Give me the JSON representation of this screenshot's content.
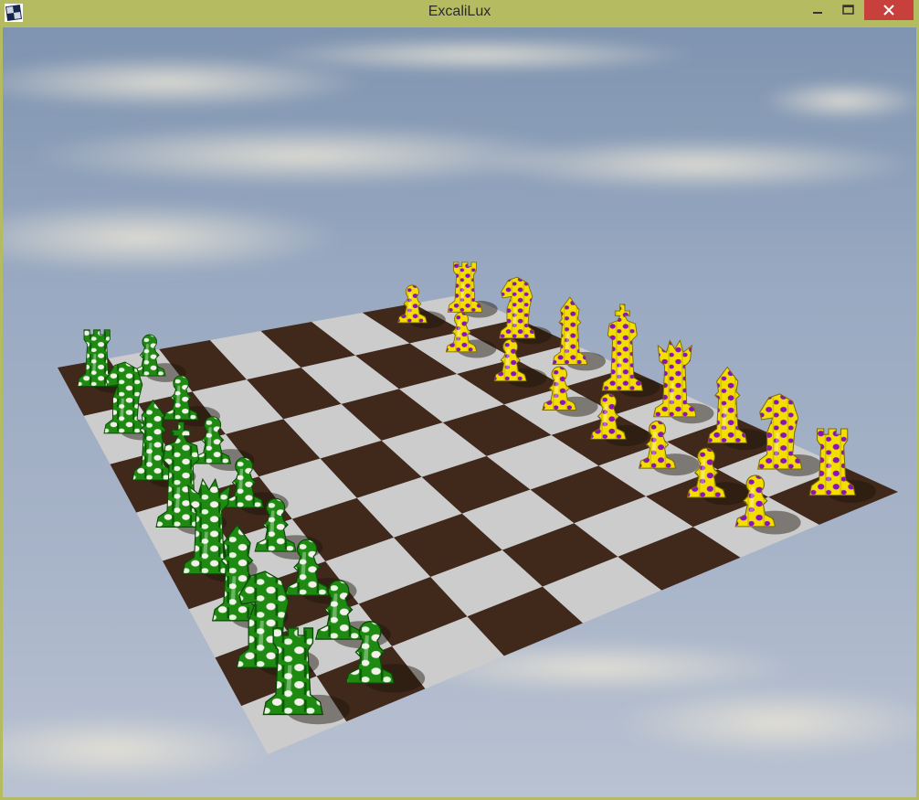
{
  "window": {
    "title": "ExcaliLux",
    "controls": {
      "minimize_icon": "minimize-icon",
      "maximize_icon": "maximize-icon",
      "close_icon": "close-icon"
    }
  },
  "colors": {
    "titlebar": "#b4bb60",
    "close_button": "#c8403b",
    "light_square": "#cccccc",
    "dark_square": "#40281a",
    "green_pieces": "#1e8a12",
    "yellow_pieces": "#f2df00",
    "purple_pattern": "#8a12b8"
  },
  "scene": {
    "board": {
      "files": 8,
      "ranks": 8
    },
    "green_pieces": [
      {
        "piece": "pawn",
        "name": "green-pawn"
      },
      {
        "piece": "pawn",
        "name": "green-pawn"
      },
      {
        "piece": "pawn",
        "name": "green-pawn"
      },
      {
        "piece": "pawn",
        "name": "green-pawn"
      },
      {
        "piece": "pawn",
        "name": "green-pawn"
      },
      {
        "piece": "pawn",
        "name": "green-pawn"
      },
      {
        "piece": "pawn",
        "name": "green-pawn"
      },
      {
        "piece": "pawn",
        "name": "green-pawn"
      },
      {
        "piece": "rook",
        "name": "green-rook"
      },
      {
        "piece": "knight",
        "name": "green-knight"
      },
      {
        "piece": "bishop",
        "name": "green-bishop"
      },
      {
        "piece": "king",
        "name": "green-king"
      },
      {
        "piece": "queen",
        "name": "green-queen"
      },
      {
        "piece": "bishop",
        "name": "green-bishop"
      },
      {
        "piece": "knight",
        "name": "green-knight"
      },
      {
        "piece": "rook",
        "name": "green-rook"
      }
    ],
    "yellow_pieces": [
      {
        "piece": "pawn",
        "name": "yellow-pawn"
      },
      {
        "piece": "pawn",
        "name": "yellow-pawn"
      },
      {
        "piece": "pawn",
        "name": "yellow-pawn"
      },
      {
        "piece": "pawn",
        "name": "yellow-pawn"
      },
      {
        "piece": "pawn",
        "name": "yellow-pawn"
      },
      {
        "piece": "pawn",
        "name": "yellow-pawn"
      },
      {
        "piece": "pawn",
        "name": "yellow-pawn"
      },
      {
        "piece": "pawn",
        "name": "yellow-pawn"
      },
      {
        "piece": "rook",
        "name": "yellow-rook"
      },
      {
        "piece": "knight",
        "name": "yellow-knight"
      },
      {
        "piece": "bishop",
        "name": "yellow-bishop"
      },
      {
        "piece": "king",
        "name": "yellow-king"
      },
      {
        "piece": "queen",
        "name": "yellow-queen"
      },
      {
        "piece": "bishop",
        "name": "yellow-bishop"
      },
      {
        "piece": "knight",
        "name": "yellow-knight"
      },
      {
        "piece": "rook",
        "name": "yellow-rook"
      }
    ]
  }
}
